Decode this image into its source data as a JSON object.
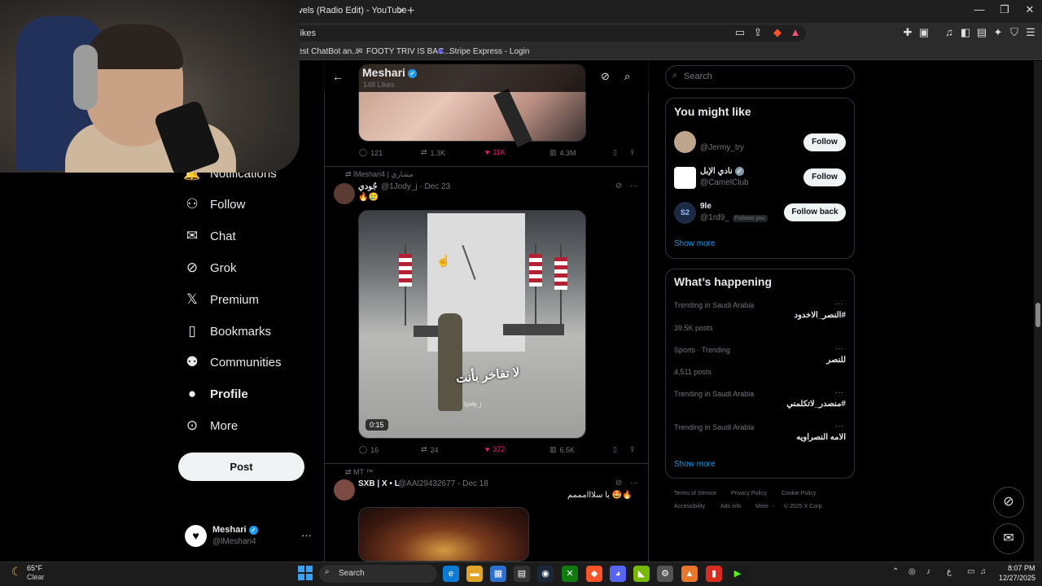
{
  "browser": {
    "tab_title": "Levels (Radio Edit) - YouTube",
    "url_text": "likes",
    "bookmarks": [
      "est ChatBot an...",
      "FOOTY TRIV IS BAC...",
      "Stripe Express - Login"
    ]
  },
  "nav": {
    "items": [
      {
        "label": "Notifications",
        "icon": "bell-icon"
      },
      {
        "label": "Follow",
        "icon": "person-add-icon"
      },
      {
        "label": "Chat",
        "icon": "mail-icon"
      },
      {
        "label": "Grok",
        "icon": "grok-icon"
      },
      {
        "label": "Premium",
        "icon": "x-logo-icon"
      },
      {
        "label": "Bookmarks",
        "icon": "bookmark-icon"
      },
      {
        "label": "Communities",
        "icon": "communities-icon"
      },
      {
        "label": "Profile",
        "icon": "person-icon"
      },
      {
        "label": "More",
        "icon": "more-circle-icon"
      }
    ],
    "post_label": "Post",
    "account": {
      "name": "Meshari",
      "handle": "@lMeshari4",
      "more": "···"
    }
  },
  "profile_header": {
    "name": "Meshari",
    "likes": "148 Likes"
  },
  "tweets": [
    {
      "stats": {
        "replies": "121",
        "reposts": "1.3K",
        "likes": "11K",
        "views": "4.3M"
      }
    },
    {
      "repost_by": "lMeshari4 | مشاري",
      "name": "جُودي",
      "handle_date": "@1Jody_j · Dec 23",
      "text": "🔥🥲",
      "video": {
        "caption": "لا تفاخر بأنت",
        "watermark": "1jody_j",
        "duration": "0:15"
      },
      "stats": {
        "replies": "16",
        "reposts": "24",
        "likes": "372",
        "views": "6.5K"
      }
    },
    {
      "repost_by": "MT ™",
      "name": "SXB | X • L",
      "handle_date": "@AAl29432677 · Dec 18",
      "text": "يا سلااامممم 🤩🔥"
    }
  ],
  "sidebar": {
    "search_placeholder": "Search",
    "you_might_like": {
      "title": "You might like",
      "users": [
        {
          "name": "",
          "handle": "@Jermy_try",
          "button": "Follow"
        },
        {
          "name": "نادي الإبل",
          "handle": "@CamelClub",
          "button": "Follow"
        },
        {
          "name": "9le",
          "handle": "@1rd9_",
          "badge": "Follows you",
          "button": "Follow back"
        }
      ],
      "show_more": "Show more"
    },
    "whats_happening": {
      "title": "What’s happening",
      "trends": [
        {
          "meta": "Trending in Saudi Arabia",
          "name": "#النصر_الاخدود",
          "posts": "39.5K posts"
        },
        {
          "meta": "Sports · Trending",
          "name": "للنصر",
          "posts": "4,511 posts"
        },
        {
          "meta": "Trending in Saudi Arabia",
          "name": "#منصدر_لاتكلمني",
          "posts": ""
        },
        {
          "meta": "Trending in Saudi Arabia",
          "name": "الامه النصراويه",
          "posts": ""
        }
      ],
      "show_more": "Show more"
    },
    "footer": [
      "Terms of Service",
      "Privacy Policy",
      "Cookie Policy",
      "Accessibility",
      "Ads info",
      "More ···",
      "© 2025 X Corp."
    ]
  },
  "taskbar": {
    "weather_temp": "65°F",
    "weather_cond": "Clear",
    "search_label": "Search",
    "time": "8:07 PM",
    "date": "12/27/2025",
    "lang": "ع"
  },
  "colors": {
    "accent": "#1d9bf0",
    "like": "#f91880",
    "border": "#2f3336"
  }
}
